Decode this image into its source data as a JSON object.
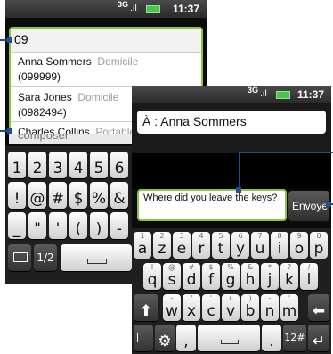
{
  "left_screen": {
    "status_time": "11:37",
    "network": "3G",
    "to_field_value": "09",
    "suggestions": [
      {
        "name": "Anna Sommers",
        "type": "Domicile",
        "number": "(099999)"
      },
      {
        "name": "Sara Jones",
        "type": "Domicile",
        "number": "(0982494)"
      },
      {
        "name": "Charles Collins",
        "type": "Portable"
      }
    ],
    "compose_text": "composer",
    "keyboard_rows": [
      [
        "1",
        "2",
        "3",
        "4",
        "5",
        "6"
      ],
      [
        "!",
        "@",
        "#",
        "$",
        "%",
        "&"
      ],
      [
        "_",
        "\"",
        "'",
        "(",
        ")",
        "-"
      ]
    ],
    "page_indicator": "1/2"
  },
  "right_screen": {
    "status_time": "11:37",
    "network": "3G",
    "to_label": "À : Anna Sommers",
    "message_text": "Where did you leave the keys?",
    "send_button": "Envoye",
    "keyboard_row1": [
      {
        "hint": "1",
        "key": "a"
      },
      {
        "hint": "2",
        "key": "z"
      },
      {
        "hint": "3",
        "key": "e"
      },
      {
        "hint": "4",
        "key": "r"
      },
      {
        "hint": "5",
        "key": "t"
      },
      {
        "hint": "6",
        "key": "y"
      },
      {
        "hint": "7",
        "key": "u"
      },
      {
        "hint": "8",
        "key": "i"
      },
      {
        "hint": "9",
        "key": "o"
      },
      {
        "hint": "0",
        "key": "p"
      }
    ],
    "keyboard_row2": [
      {
        "hint": "!",
        "key": "q"
      },
      {
        "hint": "@",
        "key": "s"
      },
      {
        "hint": "#",
        "key": "d"
      },
      {
        "hint": "$",
        "key": "f"
      },
      {
        "hint": "%",
        "key": "g"
      },
      {
        "hint": "&",
        "key": "h"
      },
      {
        "hint": "*",
        "key": "j"
      },
      {
        "hint": "?",
        "key": "k"
      },
      {
        "hint": "/",
        "key": "l"
      }
    ],
    "keyboard_row3": [
      {
        "hint": "-",
        "key": "w"
      },
      {
        "hint": "\"",
        "key": "x"
      },
      {
        "hint": "'",
        "key": "c"
      },
      {
        "hint": "(",
        "key": "v"
      },
      {
        "hint": ")",
        "key": "b"
      },
      {
        "hint": "-",
        "key": "n"
      },
      {
        "hint": "'",
        "key": "m"
      }
    ],
    "comma_key": ",",
    "period_key": ".",
    "symbols_key": "12#"
  },
  "colors": {
    "accent_green": "#8cc63f",
    "leader_blue": "#1e4f96"
  }
}
